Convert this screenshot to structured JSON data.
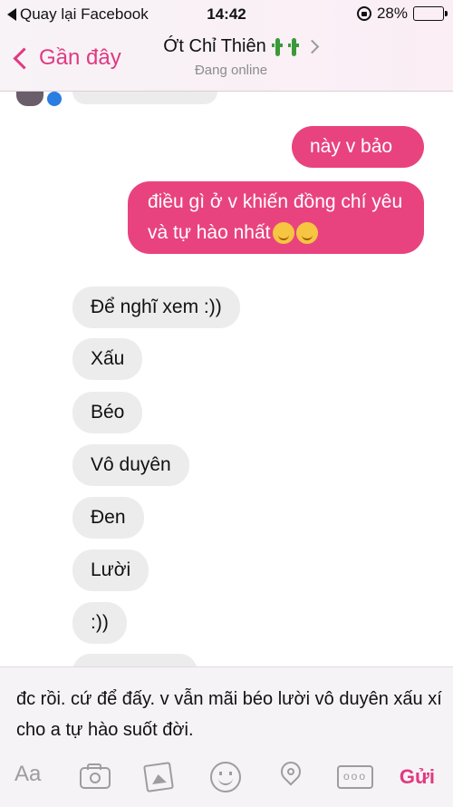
{
  "status_bar": {
    "back_label": "Quay lại Facebook",
    "time": "14:42",
    "battery_percent": "28%",
    "battery_level": 0.28,
    "battery_color": "#f2c200"
  },
  "nav": {
    "back_label": "Gần đây",
    "contact_name": "Ớt Chỉ Thiên",
    "presence": "Đang online"
  },
  "messages": [
    {
      "dir": "out",
      "text": "này v bảo"
    },
    {
      "dir": "out",
      "text": "điều gì ở v khiến đồng chí yêu và tự hào nhất"
    },
    {
      "dir": "in",
      "text": "Để nghĩ xem :))"
    },
    {
      "dir": "in",
      "text": "Xấu"
    },
    {
      "dir": "in",
      "text": "Béo"
    },
    {
      "dir": "in",
      "text": "Vô duyên"
    },
    {
      "dir": "in",
      "text": "Đen"
    },
    {
      "dir": "in",
      "text": "Lười"
    },
    {
      "dir": "in",
      "text": ":))"
    }
  ],
  "composer": {
    "text": "đc rồi. cứ để đấy. v vẫn mãi béo lười vô duyên xấu xí cho a tự hào suốt đời.",
    "aa_label": "Aa",
    "send_label": "Gửi",
    "more_label": "ooo"
  },
  "colors": {
    "accent": "#e03a82",
    "outgoing_bubble": "#e8437f",
    "incoming_bubble": "#ececec"
  },
  "icons": [
    "back-triangle-icon",
    "rotation-lock-icon",
    "battery-icon",
    "chevron-left-icon",
    "cactus-emoji-icon",
    "chevron-right-icon",
    "messenger-badge-icon",
    "relieved-face-emoji-icon",
    "camera-icon",
    "gallery-icon",
    "emoji-icon",
    "location-pin-icon",
    "more-icon"
  ]
}
